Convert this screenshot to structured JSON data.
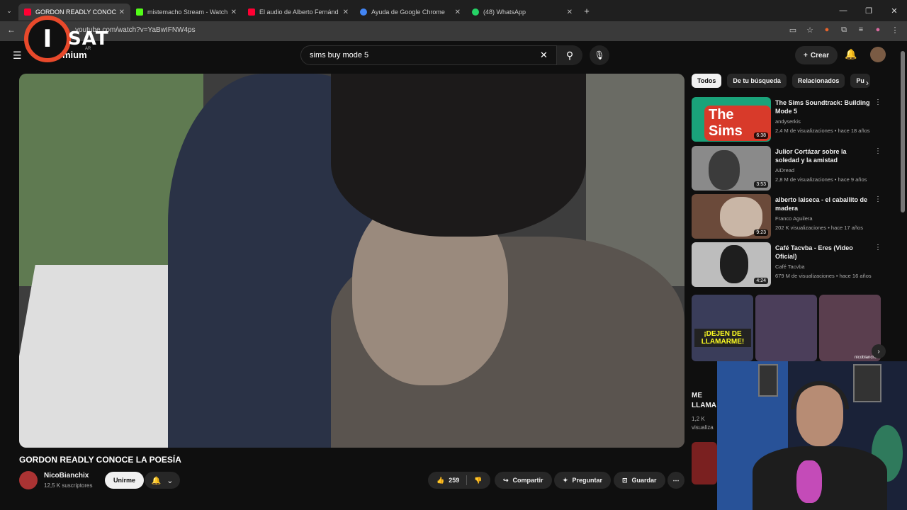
{
  "browser": {
    "tabs": [
      {
        "title": "GORDON READLY CONOCE",
        "color": "#ff0033",
        "active": true
      },
      {
        "title": "mistemacho Stream - Watch Li",
        "color": "#53fc18",
        "active": false
      },
      {
        "title": "El audio de Alberto Fernánd",
        "color": "#ff0033",
        "active": false
      },
      {
        "title": "Ayuda de Google Chrome",
        "color": "#4285f4",
        "active": false
      },
      {
        "title": "(48) WhatsApp",
        "color": "#25d366",
        "active": false
      }
    ],
    "url": "youtube.com/watch?v=YaBwIFNW4ps"
  },
  "watermark": {
    "letter": "I",
    "text": "SAT"
  },
  "header": {
    "brand": "mium",
    "country": "AR",
    "search_value": "sims buy mode 5",
    "create_label": "Crear"
  },
  "video": {
    "title": "GORDON READLY CONOCE LA POESÍA",
    "channel": "NicoBianchix",
    "subscribers": "12,5 K suscriptores",
    "join_label": "Unirme",
    "likes": "259",
    "share_label": "Compartir",
    "ask_label": "Preguntar",
    "save_label": "Guardar"
  },
  "chips": [
    "Todos",
    "De tu búsqueda",
    "Relacionados",
    "Pu"
  ],
  "recommendations": [
    {
      "title": "The Sims Soundtrack: Building Mode 5",
      "channel": "andyserkis",
      "meta": "2,4 M de visualizaciones • hace 18 años",
      "duration": "6:38",
      "thumb_color": "#1aa37a",
      "thumb_text": "The Sims"
    },
    {
      "title": "Julior Cortázar sobre la soledad y la amistad",
      "channel": "AiDread",
      "meta": "2,8 M de visualizaciones • hace 9 años",
      "duration": "3:53",
      "thumb_color": "#8a8a8a",
      "thumb_text": ""
    },
    {
      "title": "alberto laiseca - el caballito de madera",
      "channel": "Franco Aguilera",
      "meta": "202 K visualizaciones • hace 17 años",
      "duration": "9:23",
      "thumb_color": "#6b4a3a",
      "thumb_text": ""
    },
    {
      "title": "Café Tacvba - Eres (Video Oficial)",
      "channel": "Café Tacvba",
      "meta": "679 M de visualizaciones • hace 16 años",
      "duration": "4:24",
      "thumb_color": "#bdbdbd",
      "thumb_text": ""
    }
  ],
  "shorts": {
    "items": [
      {
        "color": "#3a3d5a",
        "text": "¡DEJEN DE LLAMARME!"
      },
      {
        "color": "#4b3e5a",
        "text": ""
      },
      {
        "color": "#5a3e4e",
        "text": ""
      }
    ],
    "handle": "nicobianchix",
    "first_title": "ME LLAMA",
    "first_views": "1,2 K visualiza"
  }
}
